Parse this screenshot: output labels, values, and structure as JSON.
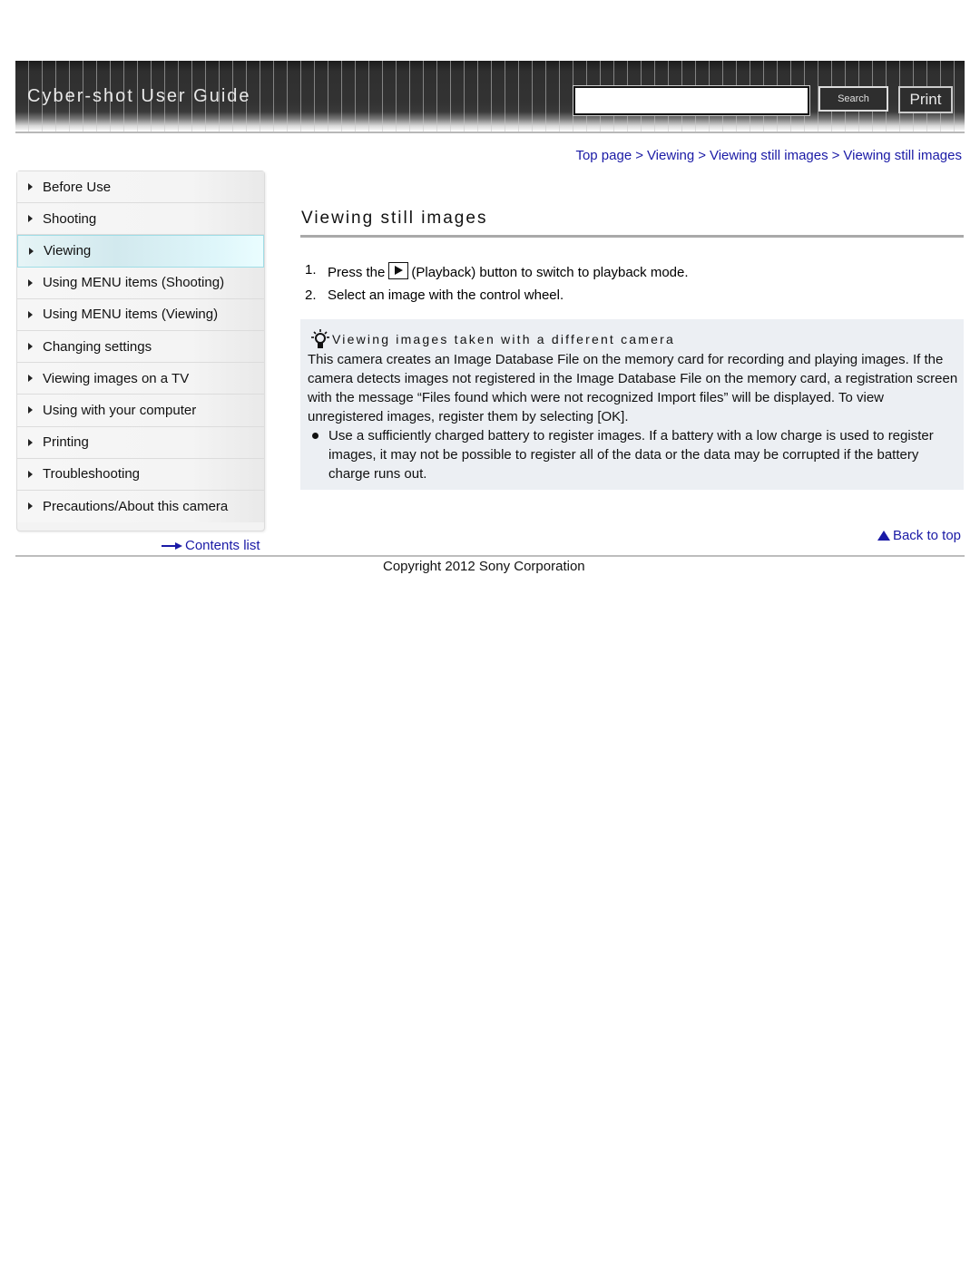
{
  "header": {
    "title": "Cyber-shot User Guide",
    "search_placeholder": "",
    "search_value": "",
    "search_label": "Search",
    "print_label": "Print"
  },
  "breadcrumb": {
    "items": [
      "Top page",
      "Viewing",
      "Viewing still images",
      "Viewing still images"
    ],
    "separator": ">"
  },
  "sidebar": {
    "items": [
      {
        "label": "Before Use",
        "active": false
      },
      {
        "label": "Shooting",
        "active": false
      },
      {
        "label": "Viewing",
        "active": true
      },
      {
        "label": "Using MENU items (Shooting)",
        "active": false
      },
      {
        "label": "Using MENU items (Viewing)",
        "active": false
      },
      {
        "label": "Changing settings",
        "active": false
      },
      {
        "label": "Viewing images on a TV",
        "active": false
      },
      {
        "label": "Using with your computer",
        "active": false
      },
      {
        "label": "Printing",
        "active": false
      },
      {
        "label": "Troubleshooting",
        "active": false
      },
      {
        "label": "Precautions/About this camera",
        "active": false
      }
    ],
    "contents_link": "Contents list"
  },
  "main": {
    "title": "Viewing still images",
    "steps": [
      {
        "num": "1.",
        "before_icon": "Press the",
        "icon": "playback-icon",
        "after_icon": "(Playback) button to switch to playback mode."
      },
      {
        "num": "2.",
        "text": "Select an image with the control wheel."
      }
    ],
    "hint": {
      "icon": "hint-lightbulb-icon",
      "heading": "Viewing images taken with a different camera",
      "body": "This camera creates an Image Database File on the memory card for recording and playing images. If the camera detects images not registered in the Image Database File on the memory card, a registration screen with the message “Files found which were not recognized Import files” will be displayed. To view unregistered images, register them by selecting [OK].",
      "bullet": "Use a sufficiently charged battery to register images. If a battery with a low charge is used to register images, it may not be possible to register all of the data or the data may be corrupted if the battery charge runs out."
    },
    "back_to_top": "Back to top"
  },
  "footer": {
    "copyright": "Copyright 2012 Sony Corporation"
  },
  "colors": {
    "link": "#1a1aa6",
    "hint_bg": "#eceff3",
    "active_nav": "#d2e9ee",
    "header_bg": "#333333"
  }
}
